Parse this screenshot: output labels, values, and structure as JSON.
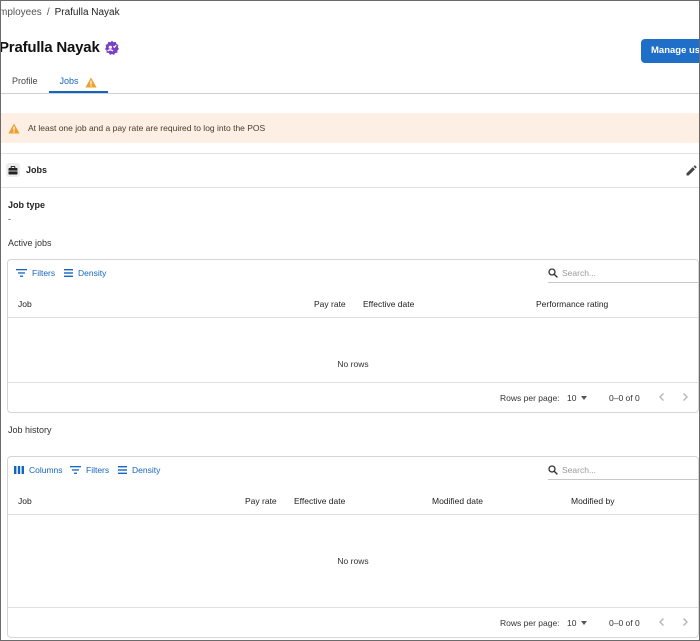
{
  "breadcrumb": {
    "parent": "mployees",
    "separator": "/",
    "current": "Prafulla Nayak"
  },
  "header": {
    "title": "Prafulla Nayak",
    "badge_icon": "verified-badge-icon",
    "manage_button_label": "Manage user"
  },
  "tabs": [
    {
      "label": "Profile",
      "active": false
    },
    {
      "label": "Jobs",
      "active": true,
      "icon": "warning-icon"
    }
  ],
  "banner": {
    "icon": "warning-icon",
    "text": "At least one job and a pay rate are required to log into the POS"
  },
  "jobs_section": {
    "title": "Jobs",
    "icon": "briefcase-icon",
    "edit_icon": "pencil-icon",
    "job_type_label": "Job type",
    "job_type_value": "-"
  },
  "active_jobs": {
    "label": "Active jobs",
    "toolbar": {
      "filters_label": "Filters",
      "density_label": "Density",
      "search_placeholder": "Search..."
    },
    "columns": [
      "Job",
      "Pay rate",
      "Effective date",
      "Performance rating"
    ],
    "empty_text": "No rows",
    "footer": {
      "rows_per_page_label": "Rows per page:",
      "rows_per_page_value": "10",
      "range": "0–0 of 0"
    }
  },
  "job_history": {
    "label": "Job history",
    "toolbar": {
      "columns_label": "Columns",
      "filters_label": "Filters",
      "density_label": "Density",
      "search_placeholder": "Search..."
    },
    "columns": [
      "Job",
      "Pay rate",
      "Effective date",
      "Modified date",
      "Modified by"
    ],
    "empty_text": "No rows",
    "footer": {
      "rows_per_page_label": "Rows per page:",
      "rows_per_page_value": "10",
      "range": "0–0 of 0"
    }
  },
  "colors": {
    "primary": "#1565c0",
    "button": "#1f6fc9",
    "warning": "#f0a030",
    "banner_bg": "#fdefe3",
    "badge": "#7b3fc4"
  }
}
